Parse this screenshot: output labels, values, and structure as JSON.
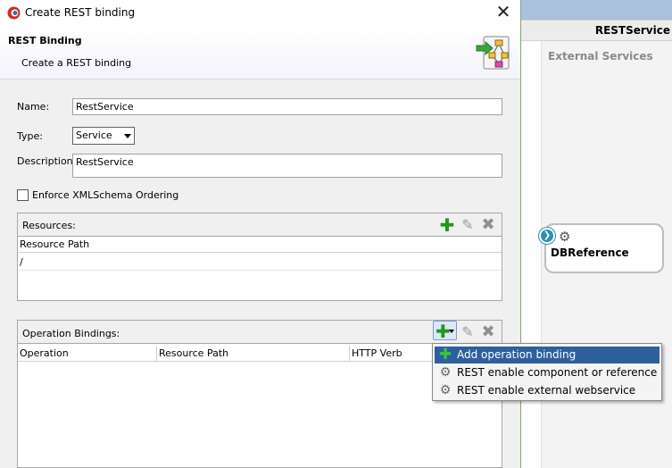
{
  "window": {
    "title": "Create REST binding"
  },
  "banner": {
    "title": "REST Binding",
    "subtitle": "Create a REST binding"
  },
  "form": {
    "name_label": "Name:",
    "name_value": "RestService",
    "type_label": "Type:",
    "type_value": "Service",
    "description_label": "Description:",
    "description_value": "RestService",
    "enforce_label": "Enforce XMLSchema Ordering",
    "enforce_checked": false
  },
  "resources": {
    "title": "Resources:",
    "columns": [
      "Resource Path"
    ],
    "rows": [
      [
        "/"
      ]
    ]
  },
  "operations": {
    "title": "Operation Bindings:",
    "columns": [
      "Operation",
      "Resource Path",
      "HTTP Verb"
    ],
    "rows": []
  },
  "add_menu": {
    "items": [
      {
        "label": "Add operation binding",
        "icon": "plus-icon",
        "selected": true
      },
      {
        "label": "REST enable component or reference",
        "icon": "gear-icon",
        "selected": false
      },
      {
        "label": "REST enable external webservice",
        "icon": "gear-globe-icon",
        "selected": false
      }
    ]
  },
  "background": {
    "composite_title": "RESTService",
    "lane_title": "External Services",
    "reference_label": "DBReference"
  },
  "colors": {
    "menu_selected": "#2e5f9e",
    "add_icon": "#1e9a1e",
    "border_accent": "#7faa6a"
  }
}
